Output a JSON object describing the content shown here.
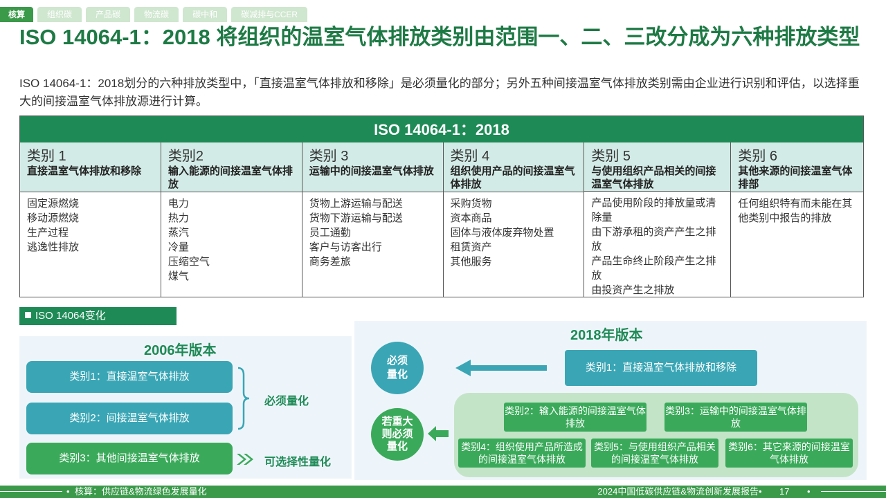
{
  "tabs": [
    "核算",
    "组织碳",
    "产品碳",
    "物流碳",
    "碳中和",
    "碳减排与CCER"
  ],
  "title": "ISO 14064-1：2018 将组织的温室气体排放类别由范围一、二、三改分成为六种排放类型",
  "subtitle": "ISO 14064-1：2018划分的六种排放类型中，「直接温室气体排放和移除」是必须量化的部分；另外五种间接温室气体排放类别需由企业进行识别和评估，以选择重大的间接温室气体排放源进行计算。",
  "table": {
    "header": "ISO 14064-1：2018",
    "columns": [
      {
        "name": "类别 1",
        "desc": "直接温室气体排放和移除",
        "items": [
          "固定源燃烧",
          "移动源燃烧",
          "生产过程",
          "逃逸性排放"
        ]
      },
      {
        "name": "类别2",
        "desc": "输入能源的间接温室气体排放",
        "items": [
          "电力",
          "热力",
          "蒸汽",
          "冷量",
          "压缩空气",
          "煤气"
        ]
      },
      {
        "name": "类别 3",
        "desc": "运输中的间接温室气体排放",
        "items": [
          "货物上游运输与配送",
          "货物下游运输与配送",
          "员工通勤",
          "客户与访客出行",
          "商务差旅"
        ]
      },
      {
        "name": "类别 4",
        "desc": "组织使用产品的间接温室气体排放",
        "items": [
          "采购货物",
          "资本商品",
          "固体与液体废弃物处置",
          "租赁资产",
          "其他服务"
        ]
      },
      {
        "name": "类别 5",
        "desc": "与使用组织产品相关的间接温室气体排放",
        "items": [
          "产品使用阶段的排放量或清除量",
          "由下游承租的资产产生之排放",
          "产品生命终止阶段产生之排放",
          "由投资产生之排放"
        ]
      },
      {
        "name": "类别 6",
        "desc": "其他来源的间接温室气体排部",
        "items": [
          "任何组织特有而未能在其他类别中报告的排放"
        ]
      }
    ]
  },
  "section_label": "ISO 14064变化",
  "v2006": {
    "title": "2006年版本",
    "cat1": "类别1：直接温室气体排放",
    "cat2": "类别2：间接温室气体排放",
    "cat3": "类别3：其他间接温室气体排放",
    "mandatory": "必须量化",
    "optional": "可选择性量化"
  },
  "v2018": {
    "title": "2018年版本",
    "circle_mandatory": "必须量化",
    "circle_significant": "若重大则必须量化",
    "cat1": "类别1：直接温室气体排放和移除",
    "cat2": "类别2：输入能源的间接温室气体排放",
    "cat3": "类别3：运输中的间接温室气体排放",
    "cat4": "类别4：组织使用产品所造成的间接温室气体排放",
    "cat5": "类别5：与使用组织产品相关的间接温室气体排放",
    "cat6": "类别6：其它来源的间接温室气体排放"
  },
  "footer": {
    "left": "核算：供应链&物流绿色发展量化",
    "right": "2024中国低碳供应链&物流创新发展报告",
    "page": "17"
  },
  "colors": {
    "primary_green": "#1e8a56",
    "teal": "#3aa6b5",
    "light_green": "#3aaa5a"
  }
}
